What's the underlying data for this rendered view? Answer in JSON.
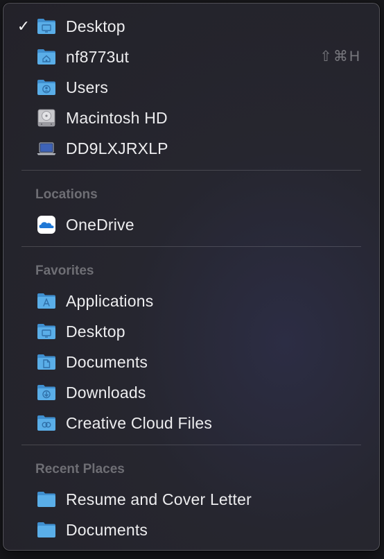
{
  "menu": {
    "top_items": [
      {
        "label": "Desktop",
        "icon": "desktop-folder-icon",
        "checked": true
      },
      {
        "label": "nf8773ut",
        "icon": "home-folder-icon",
        "shortcut": "⇧⌘H"
      },
      {
        "label": "Users",
        "icon": "users-folder-icon"
      },
      {
        "label": "Macintosh HD",
        "icon": "hard-drive-icon"
      },
      {
        "label": "DD9LXJRXLP",
        "icon": "laptop-icon"
      }
    ],
    "locations": {
      "header": "Locations",
      "items": [
        {
          "label": "OneDrive",
          "icon": "onedrive-icon"
        }
      ]
    },
    "favorites": {
      "header": "Favorites",
      "items": [
        {
          "label": "Applications",
          "icon": "applications-folder-icon"
        },
        {
          "label": "Desktop",
          "icon": "desktop-folder-icon"
        },
        {
          "label": "Documents",
          "icon": "documents-folder-icon"
        },
        {
          "label": "Downloads",
          "icon": "downloads-folder-icon"
        },
        {
          "label": "Creative Cloud Files",
          "icon": "creative-cloud-folder-icon"
        }
      ]
    },
    "recent_places": {
      "header": "Recent Places",
      "items": [
        {
          "label": "Resume and Cover Letter",
          "icon": "folder-icon"
        },
        {
          "label": "Documents",
          "icon": "folder-icon"
        }
      ]
    },
    "colors": {
      "folder_blue": "#5aaee8",
      "menu_background": "#26262f",
      "text": "#ededef",
      "header_text": "#6e6e74"
    }
  }
}
